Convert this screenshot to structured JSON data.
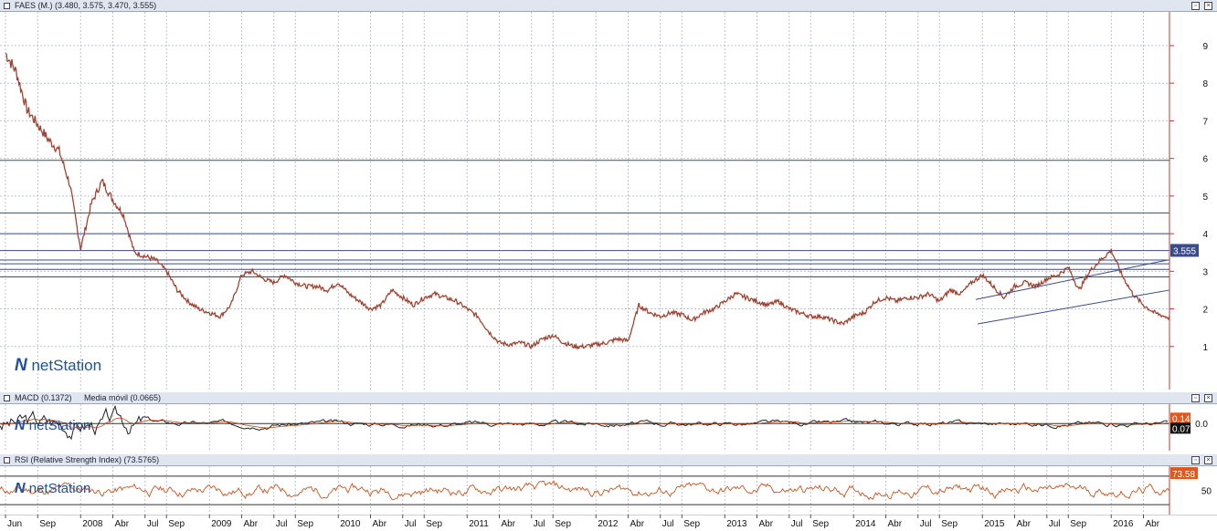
{
  "main_pane": {
    "title": "FAES (M.) (3.480, 3.575, 3.470, 3.555)",
    "last_price_label": "3.555",
    "logo": "netStation"
  },
  "macd_pane": {
    "title": "MACD (0.1372)",
    "title2": "Media móvil (0.0665)",
    "value_label_1": "0.14",
    "value_label_2": "0.07",
    "axis_label": "0.0",
    "logo": "netStation"
  },
  "rsi_pane": {
    "title": "RSI (Relative Strength Index) (73.5765)",
    "value_label": "73.58",
    "axis_label": "50",
    "logo": "netStation"
  },
  "x_axis": {
    "labels": [
      "Jun",
      "Sep",
      "2008",
      "Abr",
      "Jul",
      "Sep",
      "2009",
      "Abr",
      "Jul",
      "Sep",
      "2010",
      "Abr",
      "Jul",
      "Sep",
      "2011",
      "Abr",
      "Jul",
      "Sep",
      "2012",
      "Abr",
      "Jul",
      "Sep",
      "2013",
      "Abr",
      "Jul",
      "Sep",
      "2014",
      "Abr",
      "Jul",
      "Sep",
      "2015",
      "Abr",
      "Jul",
      "Sep",
      "2016",
      "Abr"
    ]
  },
  "colors": {
    "price_line": "#c0471c",
    "price_line_dark": "#2c3e90",
    "hline": "#3b4a8a",
    "grid": "#b8c4d6",
    "macd_line": "#222222",
    "rsi_line": "#d0521c",
    "badge_price": "#3b4a8a",
    "badge_macd1": "#e0581c",
    "badge_rsi": "#e0581c"
  },
  "chart_data": [
    {
      "type": "line",
      "name": "FAES price (monthly)",
      "ylim": [
        0,
        9.8
      ],
      "y_ticks": [
        1,
        2,
        3,
        4,
        5,
        6,
        7,
        8,
        9
      ],
      "x": [
        "2007-06",
        "2007-07",
        "2007-08",
        "2007-09",
        "2007-10",
        "2007-11",
        "2007-12",
        "2008-01",
        "2008-02",
        "2008-03",
        "2008-04",
        "2008-05",
        "2008-06",
        "2008-07",
        "2008-08",
        "2008-09",
        "2008-10",
        "2008-11",
        "2008-12",
        "2009-01",
        "2009-02",
        "2009-03",
        "2009-04",
        "2009-05",
        "2009-06",
        "2009-07",
        "2009-08",
        "2009-09",
        "2009-10",
        "2009-11",
        "2009-12",
        "2010-01",
        "2010-02",
        "2010-03",
        "2010-04",
        "2010-05",
        "2010-06",
        "2010-07",
        "2010-08",
        "2010-09",
        "2010-10",
        "2010-11",
        "2010-12",
        "2011-01",
        "2011-02",
        "2011-03",
        "2011-04",
        "2011-05",
        "2011-06",
        "2011-07",
        "2011-08",
        "2011-09",
        "2011-10",
        "2011-11",
        "2011-12",
        "2012-01",
        "2012-02",
        "2012-03",
        "2012-04",
        "2012-05",
        "2012-06",
        "2012-07",
        "2012-08",
        "2012-09",
        "2012-10",
        "2012-11",
        "2012-12",
        "2013-01",
        "2013-02",
        "2013-03",
        "2013-04",
        "2013-05",
        "2013-06",
        "2013-07",
        "2013-08",
        "2013-09",
        "2013-10",
        "2013-11",
        "2013-12",
        "2014-01",
        "2014-02",
        "2014-03",
        "2014-04",
        "2014-05",
        "2014-06",
        "2014-07",
        "2014-08",
        "2014-09",
        "2014-10",
        "2014-11",
        "2014-12",
        "2015-01",
        "2015-02",
        "2015-03",
        "2015-04",
        "2015-05",
        "2015-06",
        "2015-07",
        "2015-08",
        "2015-09",
        "2015-10",
        "2015-11",
        "2015-12",
        "2016-01",
        "2016-02",
        "2016-03",
        "2016-04",
        "2016-05",
        "2016-06",
        "2016-07"
      ],
      "values": [
        8.8,
        8.3,
        7.3,
        6.9,
        6.5,
        6.2,
        5.3,
        3.6,
        4.8,
        5.4,
        4.9,
        4.5,
        3.5,
        3.4,
        3.3,
        3.0,
        2.5,
        2.2,
        2.0,
        1.9,
        1.8,
        2.1,
        2.9,
        3.0,
        2.8,
        2.7,
        2.9,
        2.7,
        2.6,
        2.6,
        2.5,
        2.7,
        2.4,
        2.2,
        2.0,
        2.1,
        2.5,
        2.3,
        2.1,
        2.3,
        2.4,
        2.3,
        2.2,
        2.0,
        1.8,
        1.4,
        1.1,
        1.05,
        1.1,
        1.0,
        1.2,
        1.3,
        1.1,
        1.0,
        1.0,
        1.05,
        1.1,
        1.2,
        1.15,
        2.1,
        1.9,
        1.8,
        1.9,
        1.85,
        1.7,
        1.9,
        2.0,
        2.2,
        2.4,
        2.3,
        2.2,
        2.1,
        2.2,
        2.0,
        1.9,
        1.8,
        1.8,
        1.7,
        1.6,
        1.8,
        1.9,
        2.2,
        2.3,
        2.2,
        2.3,
        2.3,
        2.4,
        2.2,
        2.5,
        2.4,
        2.7,
        2.9,
        2.6,
        2.3,
        2.6,
        2.7,
        2.6,
        2.8,
        2.9,
        3.1,
        2.5,
        3.0,
        3.3,
        3.555,
        2.9,
        2.4,
        2.1,
        1.9,
        1.8,
        1.7
      ],
      "horizontal_levels": [
        2.85,
        3.05,
        3.2,
        3.3,
        3.55,
        4.0,
        4.55,
        5.95
      ]
    },
    {
      "type": "line",
      "name": "MACD",
      "ylim": [
        -0.6,
        0.4
      ],
      "y_ticks": [
        0.0
      ],
      "values_end": {
        "macd": 0.1372,
        "signal": 0.0665
      }
    },
    {
      "type": "line",
      "name": "RSI",
      "ylim": [
        20,
        80
      ],
      "y_ticks": [
        50
      ],
      "levels": [
        30,
        70
      ],
      "values_end": {
        "rsi": 73.5765
      }
    }
  ]
}
